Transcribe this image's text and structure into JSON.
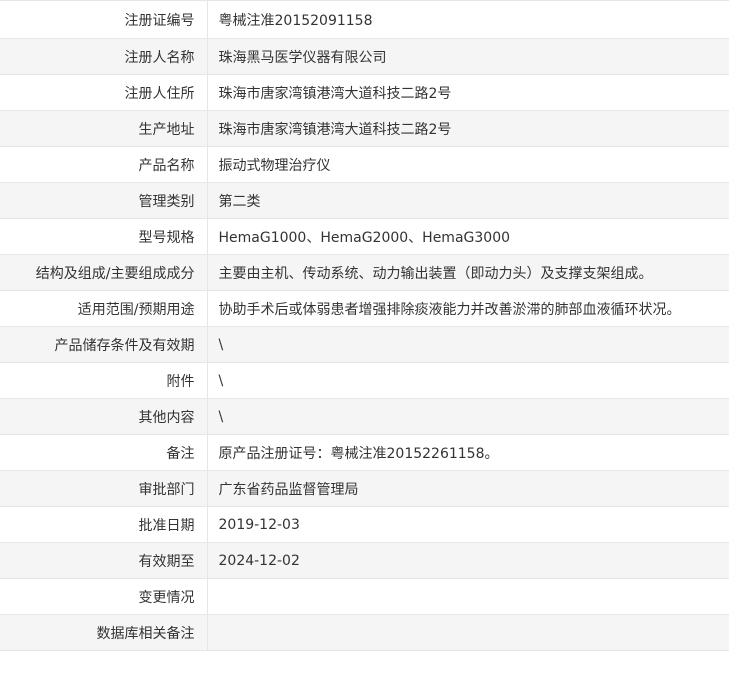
{
  "rows": [
    {
      "label": "注册证编号",
      "value": "粤械注准20152091158"
    },
    {
      "label": "注册人名称",
      "value": "珠海黑马医学仪器有限公司"
    },
    {
      "label": "注册人住所",
      "value": "珠海市唐家湾镇港湾大道科技二路2号"
    },
    {
      "label": "生产地址",
      "value": "珠海市唐家湾镇港湾大道科技二路2号"
    },
    {
      "label": "产品名称",
      "value": "振动式物理治疗仪"
    },
    {
      "label": "管理类别",
      "value": "第二类"
    },
    {
      "label": "型号规格",
      "value": "HemaG1000、HemaG2000、HemaG3000"
    },
    {
      "label": "结构及组成/主要组成成分",
      "value": "主要由主机、传动系统、动力输出装置（即动力头）及支撑支架组成。"
    },
    {
      "label": "适用范围/预期用途",
      "value": "协助手术后或体弱患者增强排除痰液能力并改善淤滞的肺部血液循环状况。"
    },
    {
      "label": "产品储存条件及有效期",
      "value": "\\"
    },
    {
      "label": "附件",
      "value": "\\"
    },
    {
      "label": "其他内容",
      "value": "\\"
    },
    {
      "label": "备注",
      "value": "原产品注册证号：粤械注准20152261158。"
    },
    {
      "label": "审批部门",
      "value": "广东省药品监督管理局"
    },
    {
      "label": "批准日期",
      "value": "2019-12-03"
    },
    {
      "label": "有效期至",
      "value": "2024-12-02"
    },
    {
      "label": "变更情况",
      "value": ""
    },
    {
      "label": "数据库相关备注",
      "value": ""
    }
  ]
}
